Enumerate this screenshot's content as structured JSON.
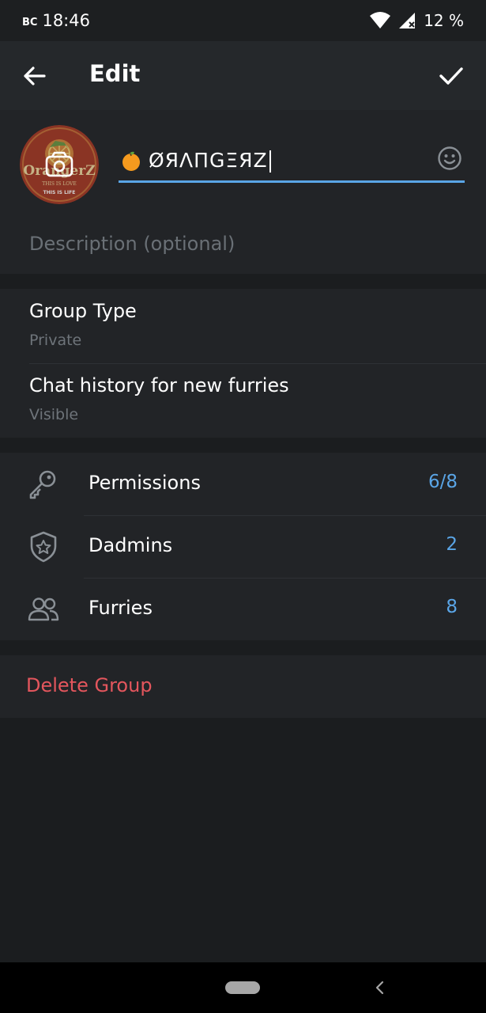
{
  "status_bar": {
    "day": "ВС",
    "time": "18:46",
    "battery": "12 %",
    "icons": [
      "wifi-icon",
      "cell-signal-icon"
    ]
  },
  "app_bar": {
    "title": "Edit",
    "back_icon": "arrow-left-icon",
    "confirm_icon": "check-icon"
  },
  "group": {
    "name_emoji": "🍊",
    "name": "ØЯΛΠGΞЯZ",
    "avatar_text": "OrangerZ",
    "avatar_small_1": "THIS IS LOVE",
    "avatar_small_2": "THIS IS LIFE",
    "description_placeholder": "Description (optional)"
  },
  "settings": [
    {
      "title": "Group Type",
      "value": "Private"
    },
    {
      "title": "Chat history for new furries",
      "value": "Visible"
    }
  ],
  "menu": [
    {
      "label": "Permissions",
      "value": "6/8",
      "icon": "key-icon"
    },
    {
      "label": "Dadmins",
      "value": "2",
      "icon": "shield-star-icon"
    },
    {
      "label": "Furries",
      "value": "8",
      "icon": "users-icon"
    }
  ],
  "danger": {
    "delete_label": "Delete Group"
  },
  "colors": {
    "accent": "#5aa5e6",
    "danger": "#e4565d",
    "background": "#1b1d1f",
    "card": "#222427",
    "app_bar": "#25282b"
  }
}
